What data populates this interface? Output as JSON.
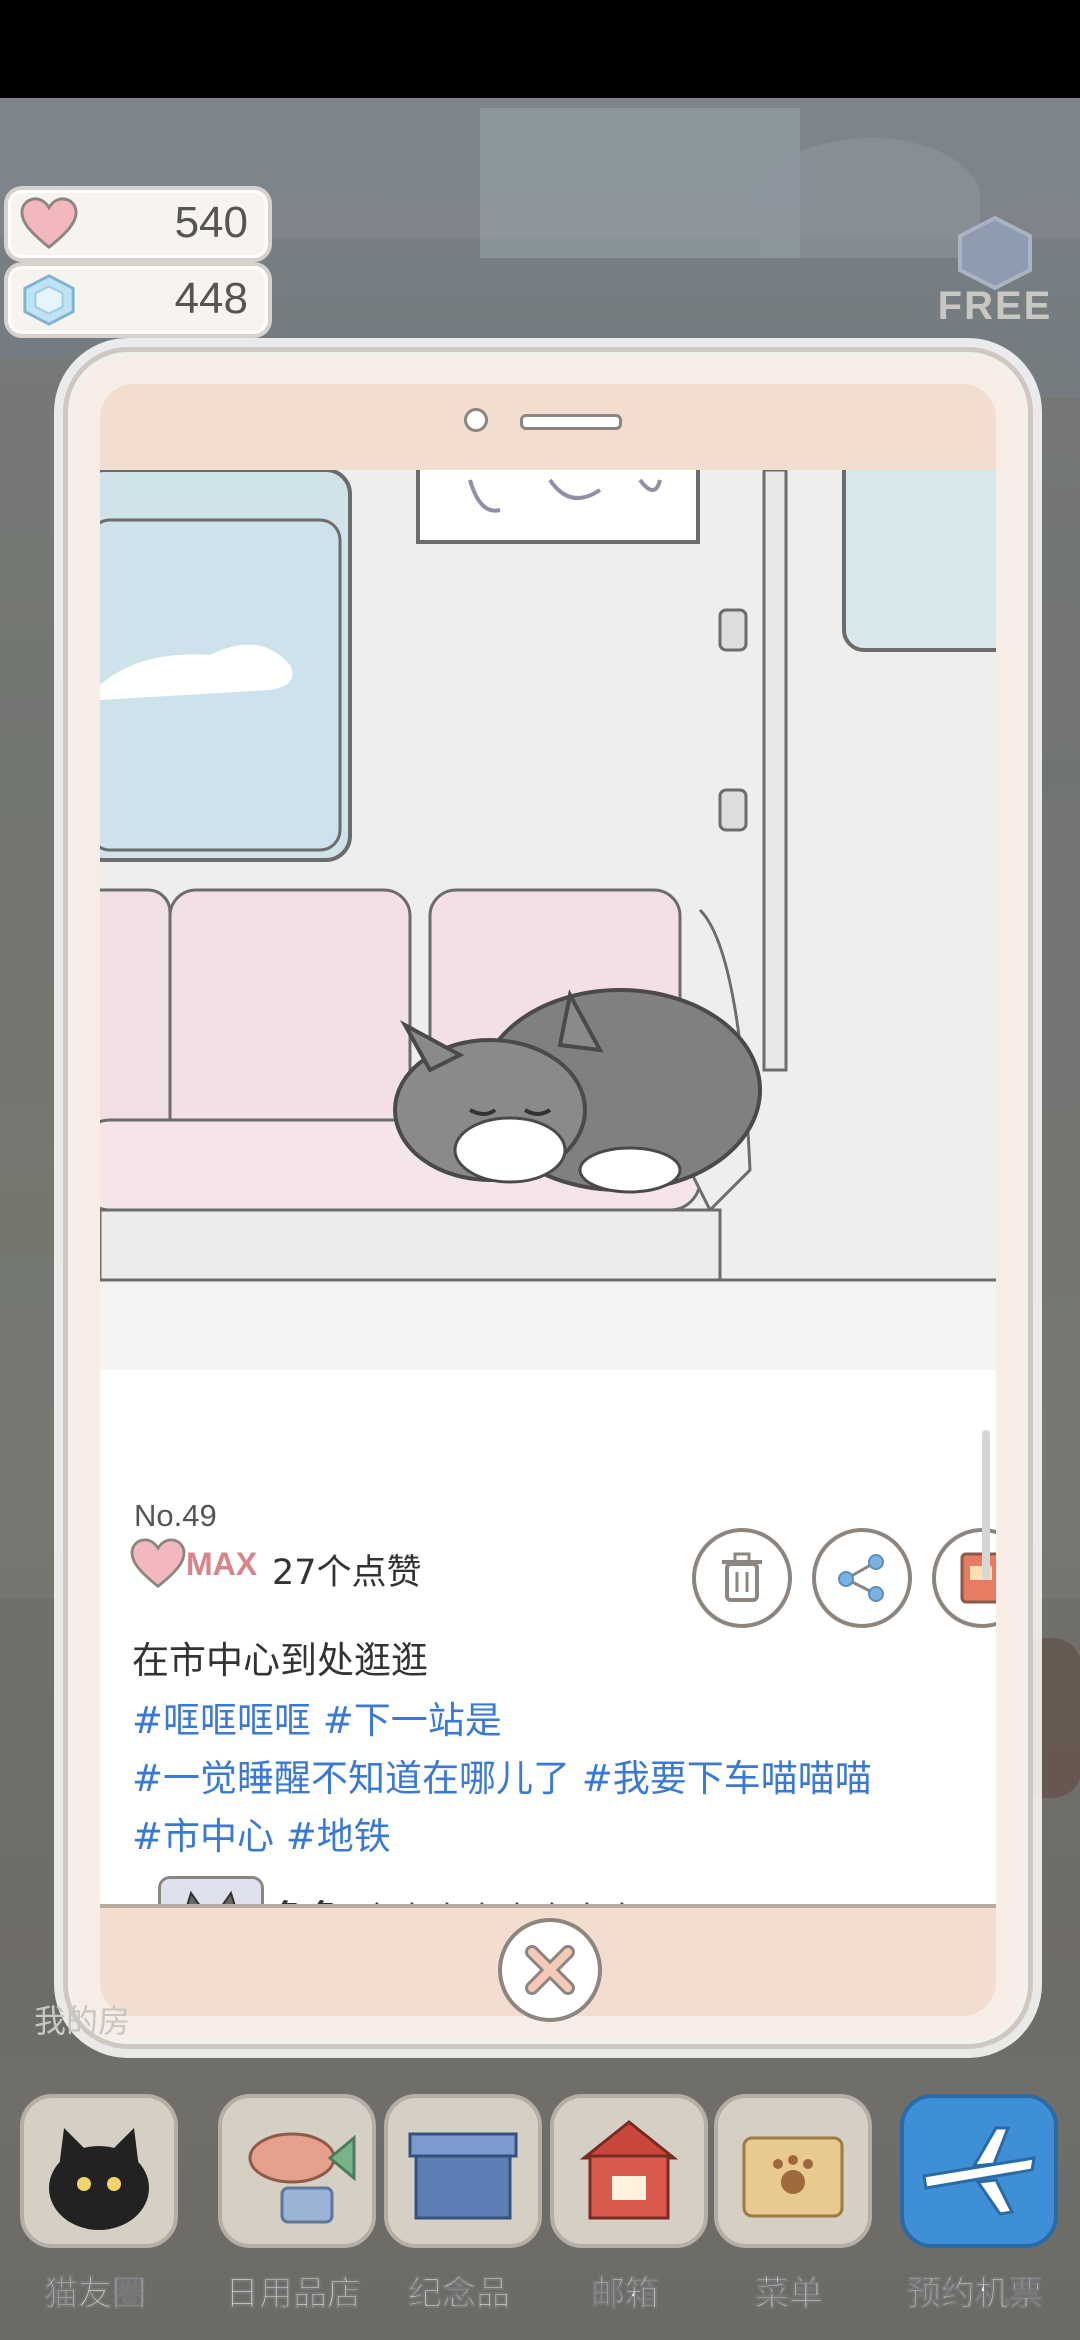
{
  "currency": {
    "hearts": "540",
    "gems": "448",
    "free_label": "FREE"
  },
  "post": {
    "number": "No.49",
    "like_level": "MAX",
    "likes": "27个点赞",
    "caption": "在市中心到处逛逛",
    "hashtag_lines": [
      "#哐哐哐哐 #下一站是",
      "#一觉睡醒不知道在哪儿了 #我要下车喵喵喵",
      "#市中心 #地铁"
    ],
    "comment": {
      "user": "鱼鱼",
      "text": "哈哈哈哈哈哈哈哈"
    },
    "actions": [
      "trash-icon",
      "share-icon",
      "album-icon"
    ]
  },
  "background_label": "我的房",
  "dock": [
    {
      "label": "猫友圈",
      "icon": "cat-icon"
    },
    {
      "label": "日用品店",
      "icon": "fish-icon"
    },
    {
      "label": "纪念品",
      "icon": "box-icon"
    },
    {
      "label": "邮箱",
      "icon": "mailbox-icon"
    },
    {
      "label": "菜单",
      "icon": "folder-icon"
    },
    {
      "label": "预约机票",
      "icon": "plane-icon"
    }
  ]
}
